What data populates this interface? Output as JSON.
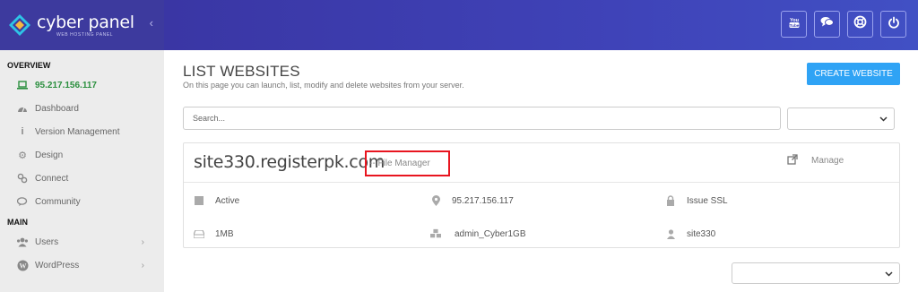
{
  "brand": {
    "name": "cyber panel",
    "tagline": "WEB HOSTING PANEL",
    "collapse_icon": "chevron-left-icon"
  },
  "sidebar": {
    "sections": [
      {
        "title": "OVERVIEW",
        "items": [
          {
            "label": "95.217.156.117",
            "icon": "laptop-icon"
          },
          {
            "label": "Dashboard",
            "icon": "dashboard-icon"
          },
          {
            "label": "Version Management",
            "icon": "info-icon"
          },
          {
            "label": "Design",
            "icon": "gear-icon"
          },
          {
            "label": "Connect",
            "icon": "link-icon"
          },
          {
            "label": "Community",
            "icon": "comments-icon"
          }
        ]
      },
      {
        "title": "MAIN",
        "items": [
          {
            "label": "Users",
            "icon": "users-icon",
            "chevron": "›"
          },
          {
            "label": "WordPress",
            "icon": "wordpress-icon",
            "chevron": "›"
          }
        ]
      }
    ]
  },
  "topbar": {
    "buttons": [
      "youtube-icon",
      "chat-icon",
      "support-icon",
      "power-icon"
    ]
  },
  "page": {
    "title": "LIST WEBSITES",
    "subtitle": "On this page you can launch, list, modify and delete websites from your server.",
    "create_button": "CREATE WEBSITE",
    "search_placeholder": "Search..."
  },
  "website": {
    "domain": "site330.registerpk.com",
    "file_manager": "-- File Manager",
    "manage": "Manage",
    "status": "Active",
    "ip": "95.217.156.117",
    "ssl": "Issue SSL",
    "disk": "1MB",
    "package": "admin_Cyber1GB",
    "owner": "site330"
  },
  "colors": {
    "sidebar_bg": "#ececec",
    "header": "#3d3a9e",
    "accent": "#2fa3f5",
    "highlight": "#e8151f",
    "ip_green": "#2a8f3e"
  }
}
